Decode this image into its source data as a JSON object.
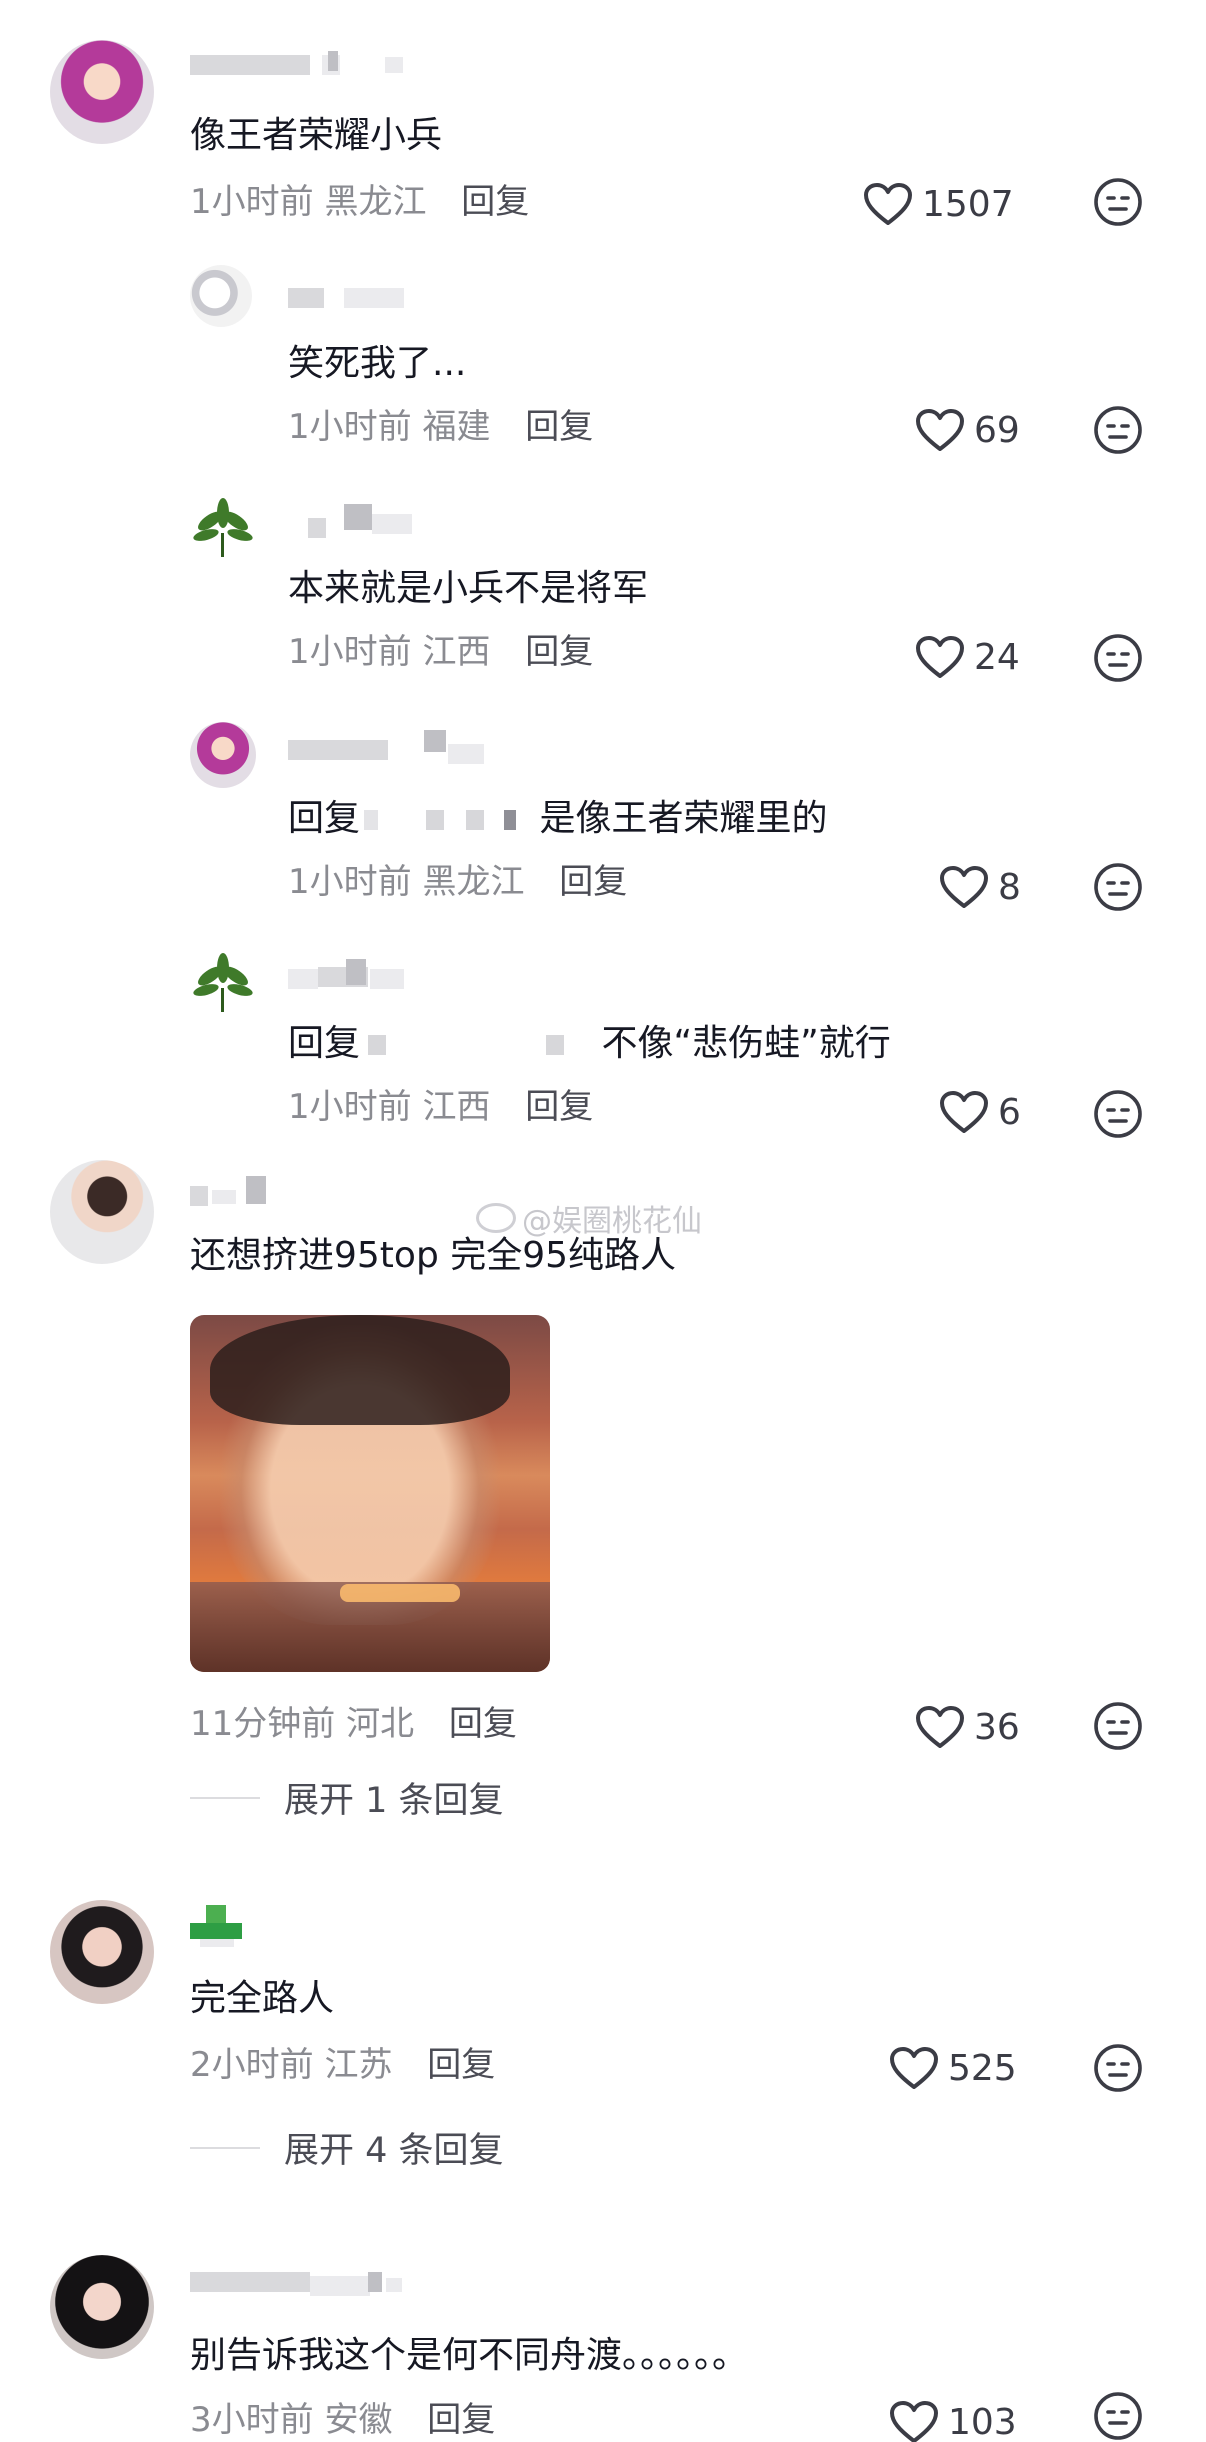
{
  "comments": [
    {
      "text": "像王者荣耀小兵",
      "time": "1小时前",
      "location": "黑龙江",
      "reply_label": "回复",
      "likes": "1507",
      "replies": [
        {
          "text": "笑死我了...",
          "time": "1小时前",
          "location": "福建",
          "reply_label": "回复",
          "likes": "69"
        },
        {
          "text": "本来就是小兵不是将军",
          "time": "1小时前",
          "location": "江西",
          "reply_label": "回复",
          "likes": "24"
        },
        {
          "reply_prefix": "回复",
          "text": "是像王者荣耀里的",
          "time": "1小时前",
          "location": "黑龙江",
          "reply_label": "回复",
          "likes": "8"
        },
        {
          "reply_prefix": "回复",
          "text": "不像“悲伤蛙”就行",
          "time": "1小时前",
          "location": "江西",
          "reply_label": "回复",
          "likes": "6"
        }
      ]
    },
    {
      "text": "还想挤进95top 完全95纯路人",
      "time": "11分钟前",
      "location": "河北",
      "reply_label": "回复",
      "likes": "36",
      "expand_label": "展开 1 条回复"
    },
    {
      "text": "完全路人",
      "time": "2小时前",
      "location": "江苏",
      "reply_label": "回复",
      "likes": "525",
      "expand_label": "展开 4 条回复"
    },
    {
      "text": "别告诉我这个是何不同舟渡。。。。。。",
      "time": "3小时前",
      "location": "安徽",
      "reply_label": "回复",
      "likes": "103"
    }
  ],
  "watermark": "@娱圈桃花仙",
  "icons": {
    "like": "heart-outline-icon",
    "dislike": "meh-face-icon"
  },
  "colors": {
    "text": "#161823",
    "meta": "#8a8b91",
    "background": "#ffffff"
  }
}
